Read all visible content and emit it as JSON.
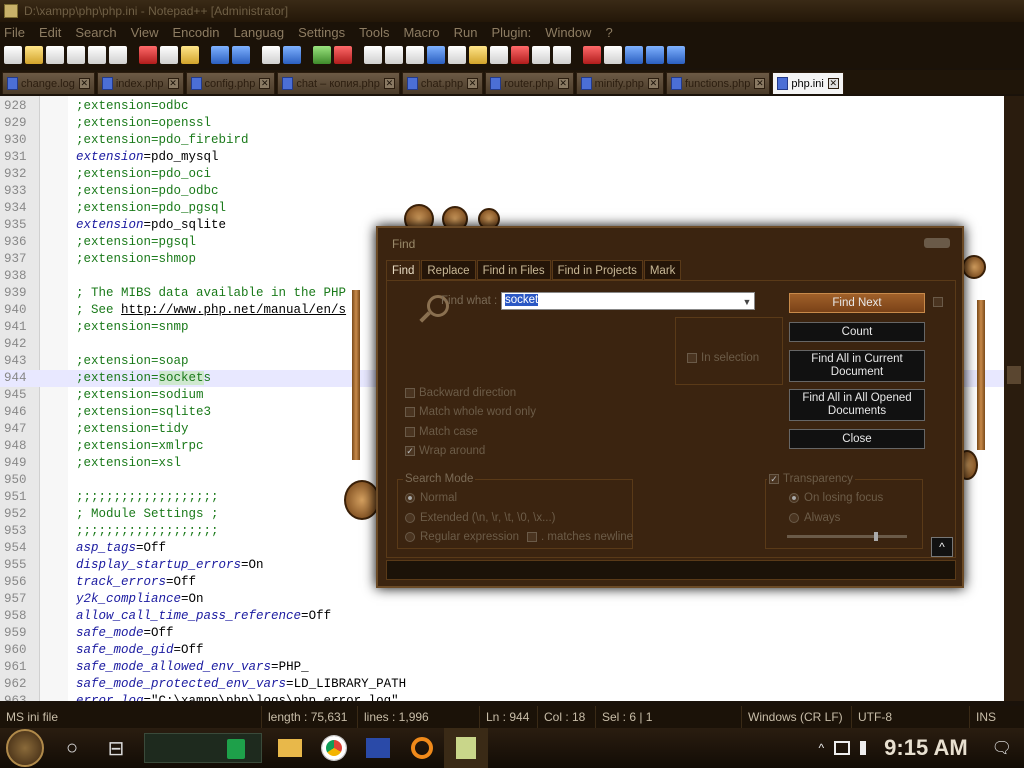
{
  "window": {
    "title": "D:\\xampp\\php\\php.ini - Notepad++ [Administrator]"
  },
  "menu": [
    "File",
    "Edit",
    "Search",
    "View",
    "Encodin",
    "Languag",
    "Settings",
    "Tools",
    "Macro",
    "Run",
    "Plugin:",
    "Window",
    "?"
  ],
  "tabs": [
    {
      "label": "change.log",
      "active": false
    },
    {
      "label": "index.php",
      "active": false
    },
    {
      "label": "config.php",
      "active": false
    },
    {
      "label": "chat – копия.php",
      "active": false
    },
    {
      "label": "chat.php",
      "active": false
    },
    {
      "label": "router.php",
      "active": false
    },
    {
      "label": "minify.php",
      "active": false
    },
    {
      "label": "functions.php",
      "active": false
    },
    {
      "label": "php.ini",
      "active": true
    }
  ],
  "tab_close_glyph": "✕",
  "editor": {
    "lines": [
      {
        "n": "928",
        "text": ";extension=odbc",
        "type": "comment"
      },
      {
        "n": "929",
        "text": ";extension=openssl",
        "type": "comment"
      },
      {
        "n": "930",
        "text": ";extension=pdo_firebird",
        "type": "comment"
      },
      {
        "n": "931",
        "kw": "extension",
        "op": "=",
        "val": "pdo_mysql",
        "type": "kv"
      },
      {
        "n": "932",
        "text": ";extension=pdo_oci",
        "type": "comment"
      },
      {
        "n": "933",
        "text": ";extension=pdo_odbc",
        "type": "comment"
      },
      {
        "n": "934",
        "text": ";extension=pdo_pgsql",
        "type": "comment"
      },
      {
        "n": "935",
        "kw": "extension",
        "op": "=",
        "val": "pdo_sqlite",
        "type": "kv"
      },
      {
        "n": "936",
        "text": ";extension=pgsql",
        "type": "comment"
      },
      {
        "n": "937",
        "text": ";extension=shmop",
        "type": "comment"
      },
      {
        "n": "938",
        "text": "",
        "type": "comment"
      },
      {
        "n": "939",
        "text": "; The MIBS data available in the PHP",
        "type": "comment"
      },
      {
        "n": "940",
        "pre": "; See ",
        "url": "http://www.php.net/manual/en/s",
        "type": "urlline"
      },
      {
        "n": "941",
        "text": ";extension=snmp",
        "type": "comment"
      },
      {
        "n": "942",
        "text": "",
        "type": "comment"
      },
      {
        "n": "943",
        "text": ";extension=soap",
        "type": "comment"
      },
      {
        "n": "944",
        "pre": ";extension=",
        "sel": "socket",
        "post": "s",
        "type": "selline"
      },
      {
        "n": "945",
        "text": ";extension=sodium",
        "type": "comment"
      },
      {
        "n": "946",
        "text": ";extension=sqlite3",
        "type": "comment"
      },
      {
        "n": "947",
        "text": ";extension=tidy",
        "type": "comment"
      },
      {
        "n": "948",
        "text": ";extension=xmlrpc",
        "type": "comment"
      },
      {
        "n": "949",
        "text": ";extension=xsl",
        "type": "comment"
      },
      {
        "n": "950",
        "text": "",
        "type": "comment"
      },
      {
        "n": "951",
        "text": ";;;;;;;;;;;;;;;;;;;",
        "type": "comment"
      },
      {
        "n": "952",
        "text": "; Module Settings ;",
        "type": "comment"
      },
      {
        "n": "953",
        "text": ";;;;;;;;;;;;;;;;;;;",
        "type": "comment"
      },
      {
        "n": "954",
        "kw": "asp_tags",
        "op": "=",
        "val": "Off",
        "type": "kv"
      },
      {
        "n": "955",
        "kw": "display_startup_errors",
        "op": "=",
        "val": "On",
        "type": "kv"
      },
      {
        "n": "956",
        "kw": "track_errors",
        "op": "=",
        "val": "Off",
        "type": "kv"
      },
      {
        "n": "957",
        "kw": "y2k_compliance",
        "op": "=",
        "val": "On",
        "type": "kv"
      },
      {
        "n": "958",
        "kw": "allow_call_time_pass_reference",
        "op": "=",
        "val": "Off",
        "type": "kv"
      },
      {
        "n": "959",
        "kw": "safe_mode",
        "op": "=",
        "val": "Off",
        "type": "kv"
      },
      {
        "n": "960",
        "kw": "safe_mode_gid",
        "op": "=",
        "val": "Off",
        "type": "kv"
      },
      {
        "n": "961",
        "kw": "safe_mode_allowed_env_vars",
        "op": "=",
        "val": "PHP_",
        "type": "kv"
      },
      {
        "n": "962",
        "kw": "safe_mode_protected_env_vars",
        "op": "=",
        "val": "LD_LIBRARY_PATH",
        "type": "kv"
      },
      {
        "n": "963",
        "kw": "error_log",
        "op": "=",
        "val": "\"C:\\xampp\\php\\logs\\php_error_log\"",
        "type": "kv"
      }
    ]
  },
  "status": {
    "filetype": "MS ini file",
    "length": "length : 75,631",
    "lines": "lines : 1,996",
    "ln": "Ln : 944",
    "col": "Col : 18",
    "sel": "Sel : 6 | 1",
    "eol": "Windows (CR LF)",
    "encoding": "UTF-8",
    "mode": "INS"
  },
  "find": {
    "title": "Find",
    "tabs": [
      "Find",
      "Replace",
      "Find in Files",
      "Find in Projects",
      "Mark"
    ],
    "find_what_label": "Find what :",
    "find_what_value": "socket",
    "in_selection": "In selection",
    "buttons": {
      "find_next": "Find Next",
      "count": "Count",
      "find_all_current": "Find All in Current Document",
      "find_all_opened": "Find All in All Opened Documents",
      "close": "Close",
      "up": "^"
    },
    "options": {
      "backward": "Backward direction",
      "whole_word": "Match whole word only",
      "match_case": "Match case",
      "wrap_around": "Wrap around"
    },
    "search_mode": {
      "title": "Search Mode",
      "normal": "Normal",
      "extended": "Extended (\\n, \\r, \\t, \\0, \\x...)",
      "regex": "Regular expression",
      "matches_newline": ". matches newline"
    },
    "transparency": {
      "title": "Transparency",
      "on_losing_focus": "On losing focus",
      "always": "Always",
      "level": 0.75
    }
  },
  "taskbar": {
    "clock": "9:15 AM",
    "search_glyph": "○",
    "taskview_glyph": "⊟",
    "expand_glyph": "^",
    "notif_glyph": "🗨"
  }
}
